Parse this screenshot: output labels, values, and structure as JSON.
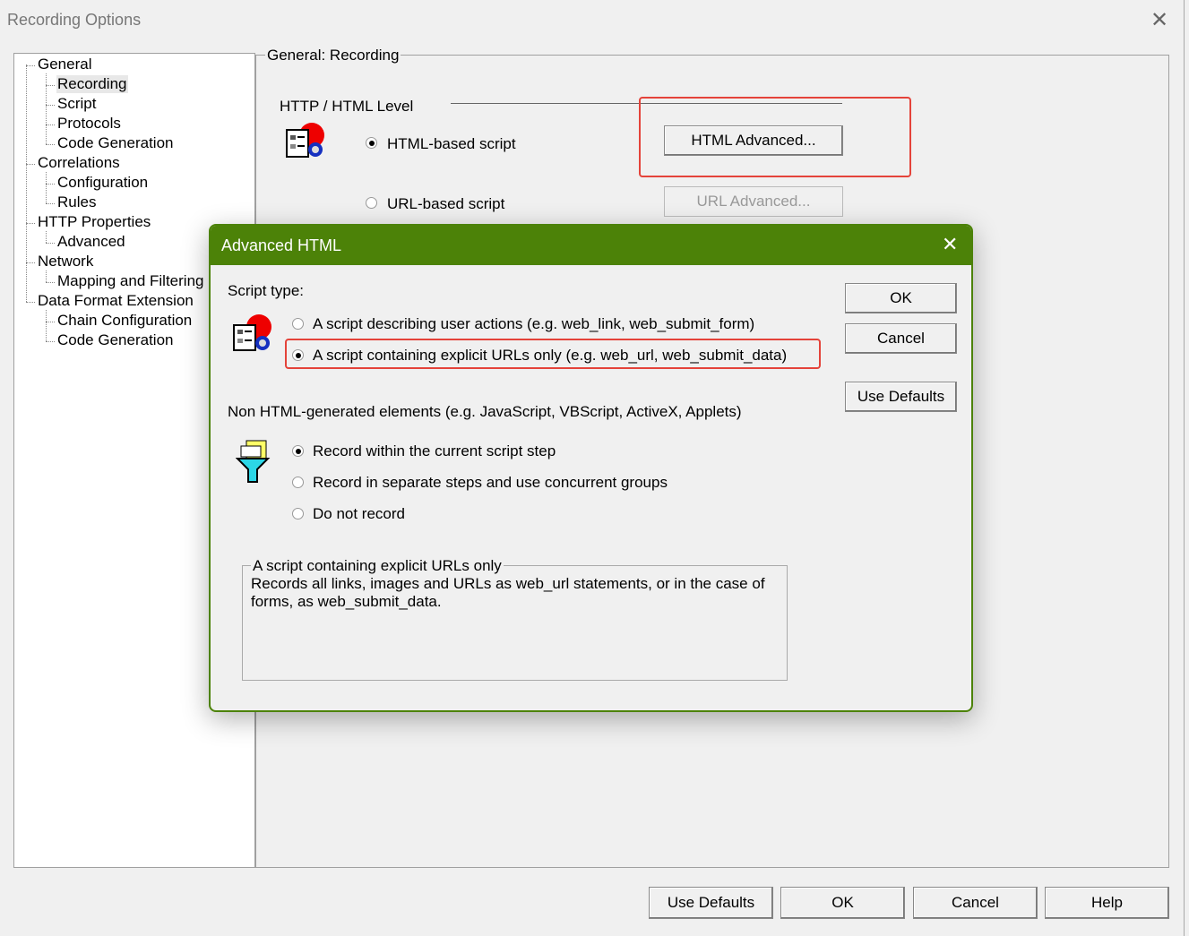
{
  "window": {
    "title": "Recording Options"
  },
  "tree": [
    {
      "label": "General",
      "level": 0
    },
    {
      "label": "Recording",
      "level": 1,
      "selected": true
    },
    {
      "label": "Script",
      "level": 1
    },
    {
      "label": "Protocols",
      "level": 1
    },
    {
      "label": "Code Generation",
      "level": 1
    },
    {
      "label": "Correlations",
      "level": 0
    },
    {
      "label": "Configuration",
      "level": 1
    },
    {
      "label": "Rules",
      "level": 1
    },
    {
      "label": "HTTP Properties",
      "level": 0
    },
    {
      "label": "Advanced",
      "level": 1
    },
    {
      "label": "Network",
      "level": 0
    },
    {
      "label": "Mapping and Filtering",
      "level": 1
    },
    {
      "label": "Data Format Extension",
      "level": 0
    },
    {
      "label": "Chain Configuration",
      "level": 1
    },
    {
      "label": "Code Generation",
      "level": 1
    }
  ],
  "panel": {
    "title": "General: Recording",
    "section": "HTTP / HTML Level",
    "html_based": "HTML-based script",
    "url_based": "URL-based script",
    "html_advanced": "HTML Advanced...",
    "url_advanced": "URL Advanced..."
  },
  "footer": {
    "use_defaults": "Use Defaults",
    "ok": "OK",
    "cancel": "Cancel",
    "help": "Help"
  },
  "dialog": {
    "title": "Advanced HTML",
    "accent": "#4c8208",
    "script_type_label": "Script type:",
    "opt_user_actions": "A script describing user actions (e.g. web_link, web_submit_form)",
    "opt_explicit_urls": "A script containing explicit URLs only (e.g. web_url, web_submit_data)",
    "non_html_label": "Non HTML-generated elements (e.g. JavaScript, VBScript, ActiveX, Applets)",
    "opt_current_step": "Record within the current script step",
    "opt_separate_steps": "Record in separate steps and use concurrent groups",
    "opt_do_not_record": "Do not record",
    "desc_title": "A script containing explicit URLs only",
    "desc_text": "Records all links, images and URLs as web_url statements, or in the case of forms, as web_submit_data.",
    "ok": "OK",
    "cancel": "Cancel",
    "use_defaults": "Use Defaults"
  }
}
